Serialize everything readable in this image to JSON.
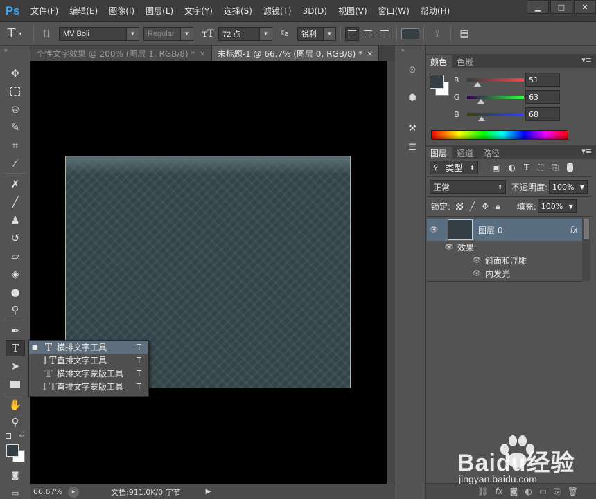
{
  "app": {
    "logo": "Ps"
  },
  "menubar": {
    "items": [
      "文件(F)",
      "编辑(E)",
      "图像(I)",
      "图层(L)",
      "文字(Y)",
      "选择(S)",
      "滤镜(T)",
      "3D(D)",
      "视图(V)",
      "窗口(W)",
      "帮助(H)"
    ]
  },
  "window_controls": {
    "minimize": "▁",
    "maximize": "□",
    "close": "✕"
  },
  "options": {
    "font_family": "MV Boli",
    "font_style": "Regular",
    "font_size": "72 点",
    "aa_label": "ªa",
    "antialias": "锐利"
  },
  "documents": {
    "tabs": [
      {
        "title": "个性文字效果 @ 200% (图层 1, RGB/8) *",
        "close": "×"
      },
      {
        "title": "未标题-1 @ 66.7% (图层 0, RGB/8) *",
        "close": "×"
      }
    ],
    "active_tab": 1
  },
  "status": {
    "zoom": "66.67%",
    "doc_info": "文档:911.0K/0 字节"
  },
  "tool_flyout": {
    "items": [
      {
        "label": "横排文字工具",
        "shortcut": "T",
        "selected": true
      },
      {
        "label": "直排文字工具",
        "shortcut": "T",
        "selected": false
      },
      {
        "label": "横排文字蒙版工具",
        "shortcut": "T",
        "selected": false
      },
      {
        "label": "直排文字蒙版工具",
        "shortcut": "T",
        "selected": false
      }
    ]
  },
  "color_panel": {
    "tabs": [
      "颜色",
      "色板"
    ],
    "channels": [
      {
        "label": "R",
        "value": "51"
      },
      {
        "label": "G",
        "value": "63"
      },
      {
        "label": "B",
        "value": "68"
      }
    ],
    "foreground": "#333f44",
    "background": "#ffffff"
  },
  "layers_panel": {
    "tabs": [
      "图层",
      "通道",
      "路径"
    ],
    "filter_label": "类型",
    "blend_mode": "正常",
    "opacity_label": "不透明度:",
    "opacity": "100%",
    "lock_label": "锁定:",
    "fill_label": "填充:",
    "fill": "100%",
    "layer": {
      "name": "图层 0",
      "fx": "fx"
    },
    "effects_label": "效果",
    "effects": [
      "斜面和浮雕",
      "内发光"
    ]
  },
  "watermark": {
    "brand": "Baidu经验",
    "url": "jingyan.baidu.com"
  },
  "colors": {
    "accent": "#31a8ff",
    "canvas_fill": "#374a50",
    "selection": "#5f6e7d"
  }
}
